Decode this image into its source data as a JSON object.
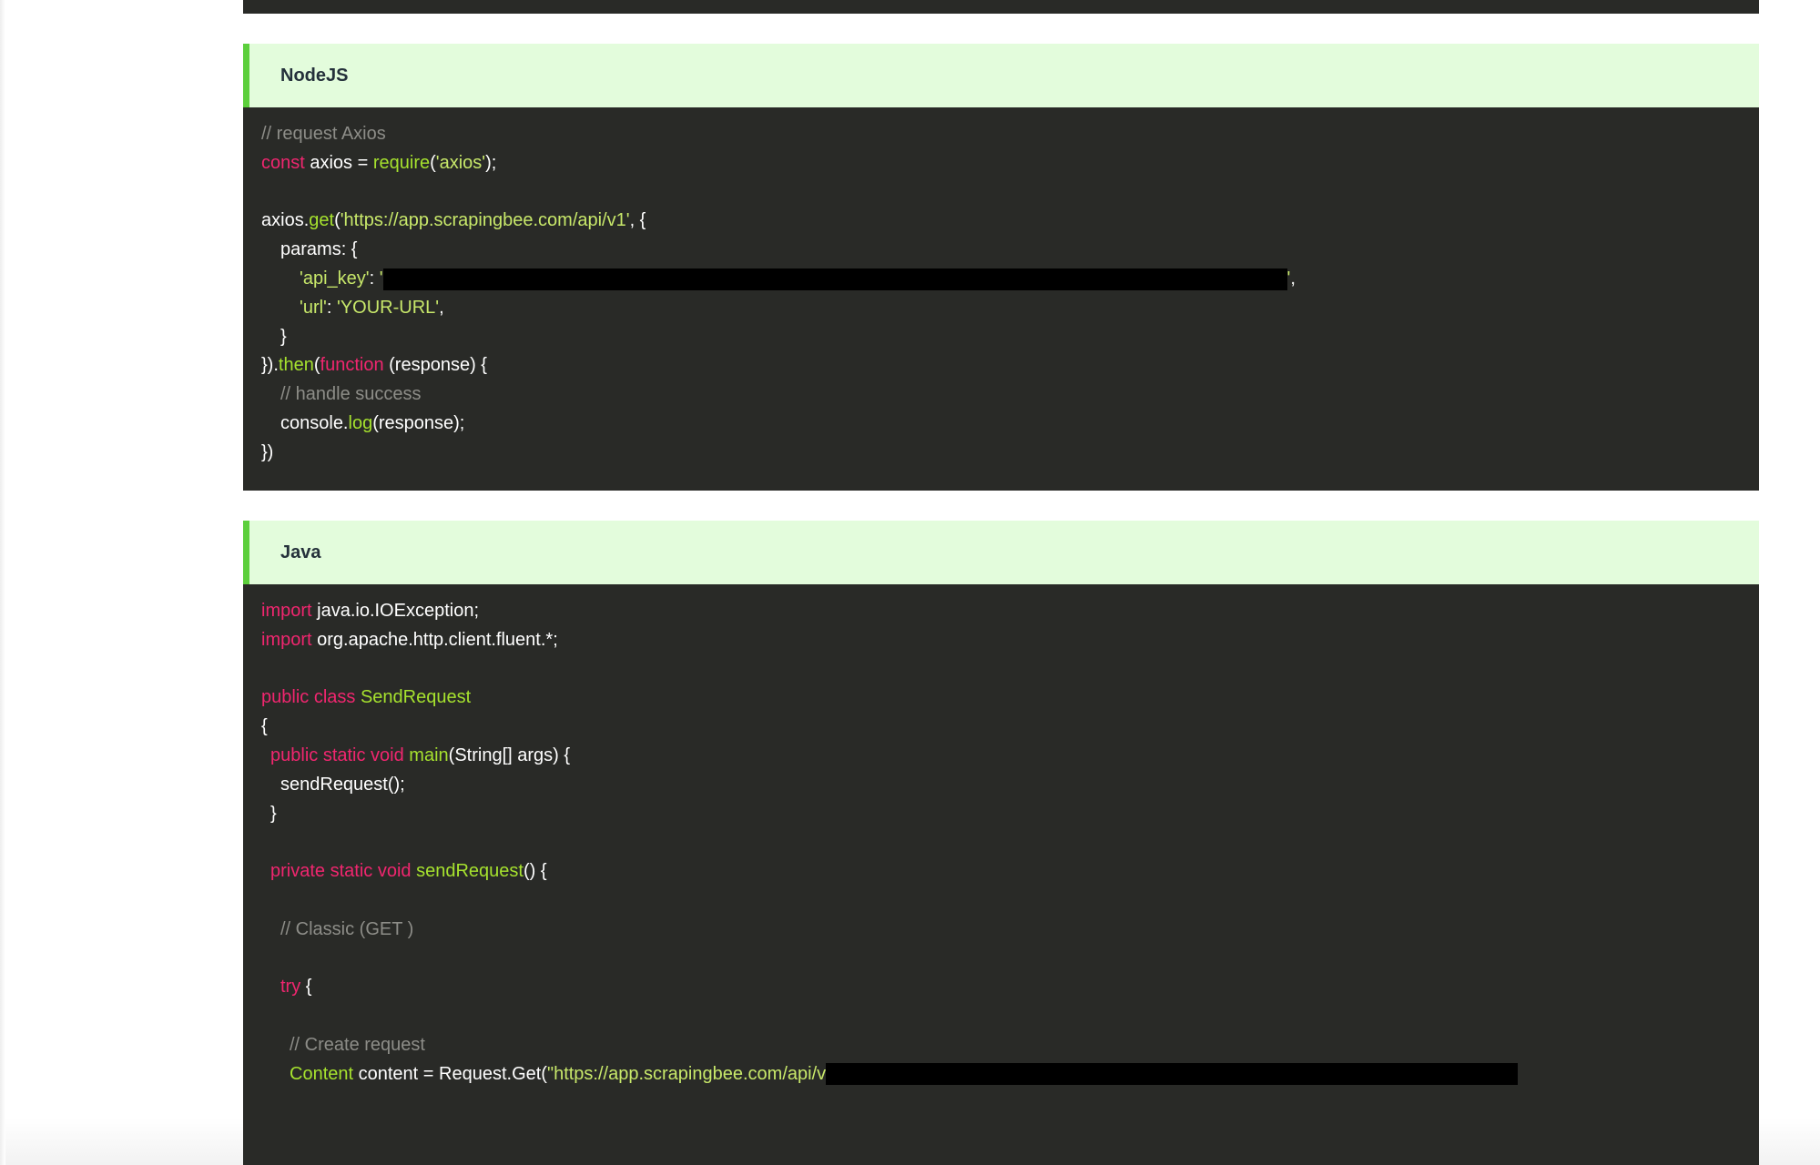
{
  "blocks": [
    {
      "title": "NodeJS",
      "code": {
        "c1": "// request Axios",
        "l2_kw": "const",
        "l2_a": " axios = ",
        "l2_fn": "require",
        "l2_b": "(",
        "l2_str": "'axios'",
        "l2_c": ");",
        "l4_a": "axios.",
        "l4_fn": "get",
        "l4_b": "(",
        "l4_str": "'https://app.scrapingbee.com/api/v1'",
        "l4_c": ", {",
        "l5": "params: {",
        "l6_str1": "'api_key'",
        "l6_a": ": ",
        "l6_str2": "'",
        "l6_str3": "'",
        "l6_b": ",",
        "l7_str1": "'url'",
        "l7_a": ": ",
        "l7_str2": "'YOUR-URL'",
        "l7_b": ",",
        "l8": "}",
        "l9_a": "}).",
        "l9_fn": "then",
        "l9_b": "(",
        "l9_kw": "function",
        "l9_c": " (response) {",
        "c10": "// handle success",
        "l11_a": "console.",
        "l11_fn": "log",
        "l11_b": "(response);",
        "l12": "})"
      }
    },
    {
      "title": "Java",
      "code": {
        "l1_kw": "import",
        "l1_a": " java.io.IOException;",
        "l2_kw": "import",
        "l2_a": " org.apache.http.client.fluent.*;",
        "l4_kw": "public class",
        "l4_fn": " SendRequest",
        "l5": "{",
        "l6_kw": "public static void",
        "l6_fn": " main",
        "l6_a": "(String[] args) {",
        "l7": "sendRequest();",
        "l8": "}",
        "l10_kw": "private static void",
        "l10_fn": " sendRequest",
        "l10_a": "() {",
        "c12": "// Classic (GET )",
        "l14_kw": "try",
        "l14_a": " {",
        "c16": "// Create request",
        "l17_fn": "Content",
        "l17_a": " content = Request.Get(",
        "l17_str": "\"https://app.scrapingbee.com/api/v"
      }
    }
  ],
  "colors": {
    "code_bg": "#292a27",
    "header_bg": "#e3fcdc",
    "header_accent": "#5ccf3c",
    "keyword": "#f0266f",
    "function": "#a6e22e",
    "string": "#c8e86a",
    "comment": "#8d8d88"
  }
}
